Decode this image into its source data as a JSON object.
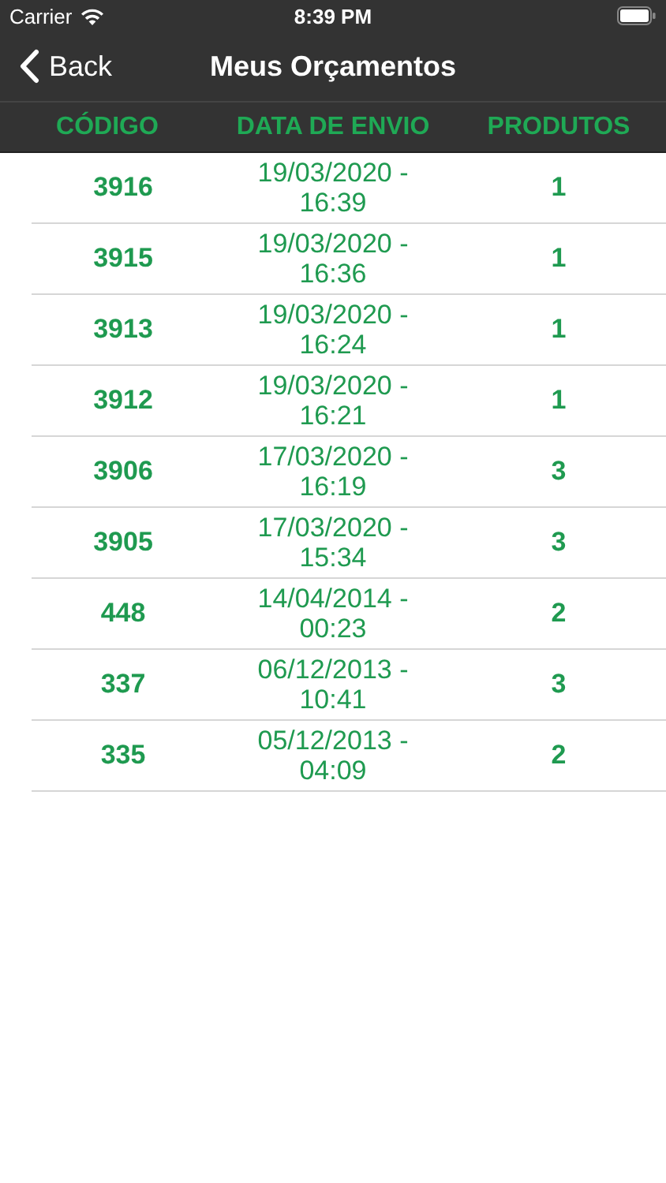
{
  "status_bar": {
    "carrier": "Carrier",
    "time": "8:39 PM"
  },
  "nav_bar": {
    "back": "Back",
    "title": "Meus Orçamentos"
  },
  "table": {
    "columns": [
      "CÓDIGO",
      "DATA DE ENVIO",
      "PRODUTOS"
    ],
    "rows": [
      {
        "code": "3916",
        "date": "19/03/2020 - 16:39",
        "products": "1"
      },
      {
        "code": "3915",
        "date": "19/03/2020 - 16:36",
        "products": "1"
      },
      {
        "code": "3913",
        "date": "19/03/2020 - 16:24",
        "products": "1"
      },
      {
        "code": "3912",
        "date": "19/03/2020 - 16:21",
        "products": "1"
      },
      {
        "code": "3906",
        "date": "17/03/2020 - 16:19",
        "products": "3"
      },
      {
        "code": "3905",
        "date": "17/03/2020 - 15:34",
        "products": "3"
      },
      {
        "code": "448",
        "date": "14/04/2014 - 00:23",
        "products": "2"
      },
      {
        "code": "337",
        "date": "06/12/2013 - 10:41",
        "products": "3"
      },
      {
        "code": "335",
        "date": "05/12/2013 - 04:09",
        "products": "2"
      }
    ]
  }
}
